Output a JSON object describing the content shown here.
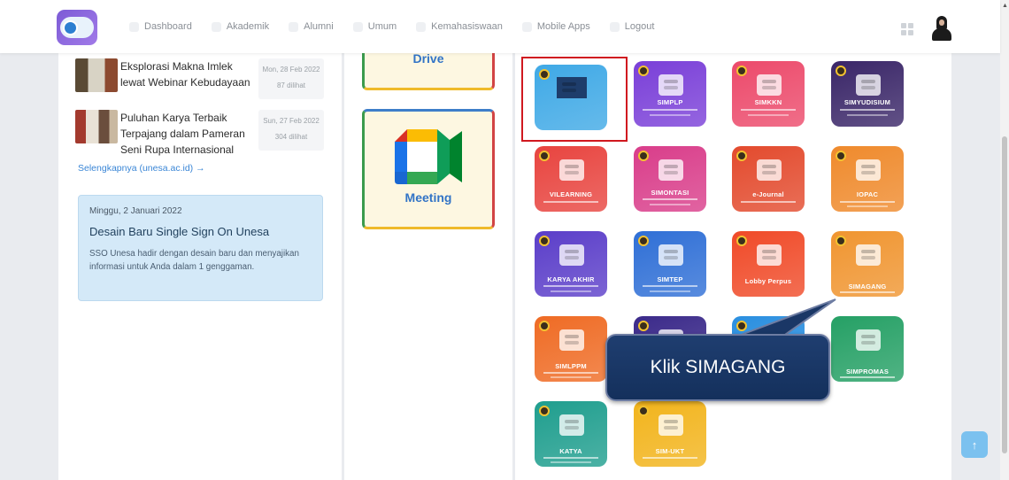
{
  "nav": {
    "items": [
      "Dashboard",
      "Akademik",
      "Alumni",
      "Umum",
      "Kemahasiswaan",
      "Mobile Apps",
      "Logout"
    ]
  },
  "news": [
    {
      "title": "Eksplorasi Makna Imlek lewat Webinar Kebudayaan",
      "date": "Mon, 28 Feb 2022",
      "views": "87 dilihat"
    },
    {
      "title": "Puluhan Karya Terbaik Terpajang dalam Pameran Seni Rupa Internasional",
      "date": "Sun, 27 Feb 2022",
      "views": "304 dilihat"
    }
  ],
  "more_link": "Selengkapnya (unesa.ac.id) →",
  "announcement": {
    "date": "Minggu, 2 Januari 2022",
    "title": "Desain Baru Single Sign On Unesa",
    "body": "SSO Unesa hadir dengan desain baru dan menyajikan informasi untuk Anda dalam 1 genggaman."
  },
  "google_apps": [
    "Drive",
    "Meeting"
  ],
  "apps": [
    {
      "name": "",
      "color": "#3fa9e6"
    },
    {
      "name": "SIMPLP",
      "color": "#7a3fd8"
    },
    {
      "name": "SIMKKN",
      "color": "#ec4a6b"
    },
    {
      "name": "SIMYUDISIUM",
      "color": "#3a2668"
    },
    {
      "name": "VILEARNING",
      "color": "#e8443f"
    },
    {
      "name": "SIMONTASI",
      "color": "#d93d8a"
    },
    {
      "name": "e-Journal",
      "color": "#e34a2d"
    },
    {
      "name": "IOPAC",
      "color": "#ef8a2c"
    },
    {
      "name": "KARYA AKHIR",
      "color": "#5b3ec9"
    },
    {
      "name": "SIMTEP",
      "color": "#2f6fd6"
    },
    {
      "name": "Lobby Perpus",
      "color": "#f04a28"
    },
    {
      "name": "SIMAGANG",
      "color": "#f09530"
    },
    {
      "name": "SIMLPPM",
      "color": "#ef6b24"
    },
    {
      "name": "",
      "color": "#3b2a8a"
    },
    {
      "name": "",
      "color": "#2a8fe0"
    },
    {
      "name": "SIMPROMAS",
      "color": "#25a065"
    },
    {
      "name": "KATYA",
      "color": "#1f9e8e"
    },
    {
      "name": "SIM-UKT",
      "color": "#f2b41c"
    }
  ],
  "callout": {
    "text": "Klik SIMAGANG"
  },
  "back_to_top": "↑"
}
